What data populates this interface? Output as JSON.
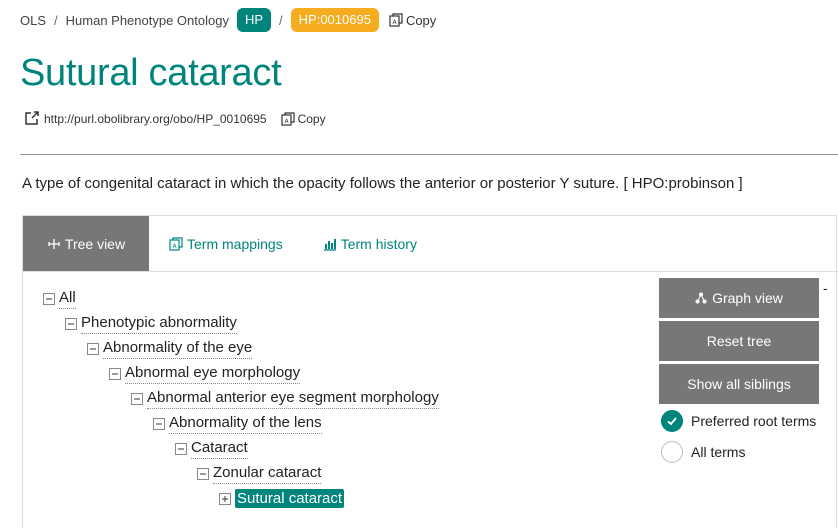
{
  "breadcrumb": {
    "root": "OLS",
    "separator": "/",
    "ontology": "Human Phenotype Ontology",
    "ontology_badge": "HP",
    "term_badge": "HP:0010695",
    "copy_label": "Copy"
  },
  "term": {
    "title": "Sutural cataract",
    "iri": "http://purl.obolibrary.org/obo/HP_0010695",
    "copy_label": "Copy",
    "description": "A type of congenital cataract in which the opacity follows the anterior or posterior Y suture. [ HPO:probinson ]"
  },
  "tabs": [
    {
      "label": "Tree view",
      "icon": "tree-icon",
      "active": true
    },
    {
      "label": "Term mappings",
      "icon": "mappings-icon",
      "active": false
    },
    {
      "label": "Term history",
      "icon": "chart-bar-icon",
      "active": false
    }
  ],
  "tree": {
    "nodes": [
      {
        "label": "All",
        "toggle": "collapse"
      },
      {
        "label": "Phenotypic abnormality",
        "toggle": "collapse"
      },
      {
        "label": "Abnormality of the eye",
        "toggle": "collapse"
      },
      {
        "label": "Abnormal eye morphology",
        "toggle": "collapse"
      },
      {
        "label": "Abnormal anterior eye segment morphology",
        "toggle": "collapse"
      },
      {
        "label": "Abnormality of the lens",
        "toggle": "collapse"
      },
      {
        "label": "Cataract",
        "toggle": "collapse"
      },
      {
        "label": "Zonular cataract",
        "toggle": "collapse"
      },
      {
        "label": "Sutural cataract",
        "toggle": "expand",
        "selected": true
      }
    ]
  },
  "side": {
    "graph_view": "Graph view",
    "reset_tree": "Reset tree",
    "show_siblings": "Show all siblings",
    "dash": "-",
    "preferred_roots": "Preferred root terms",
    "all_terms": "All terms",
    "preferred_checked": true
  },
  "colors": {
    "accent": "#00857d",
    "badge_orange": "#f5ac1f",
    "button_gray": "#777777"
  }
}
